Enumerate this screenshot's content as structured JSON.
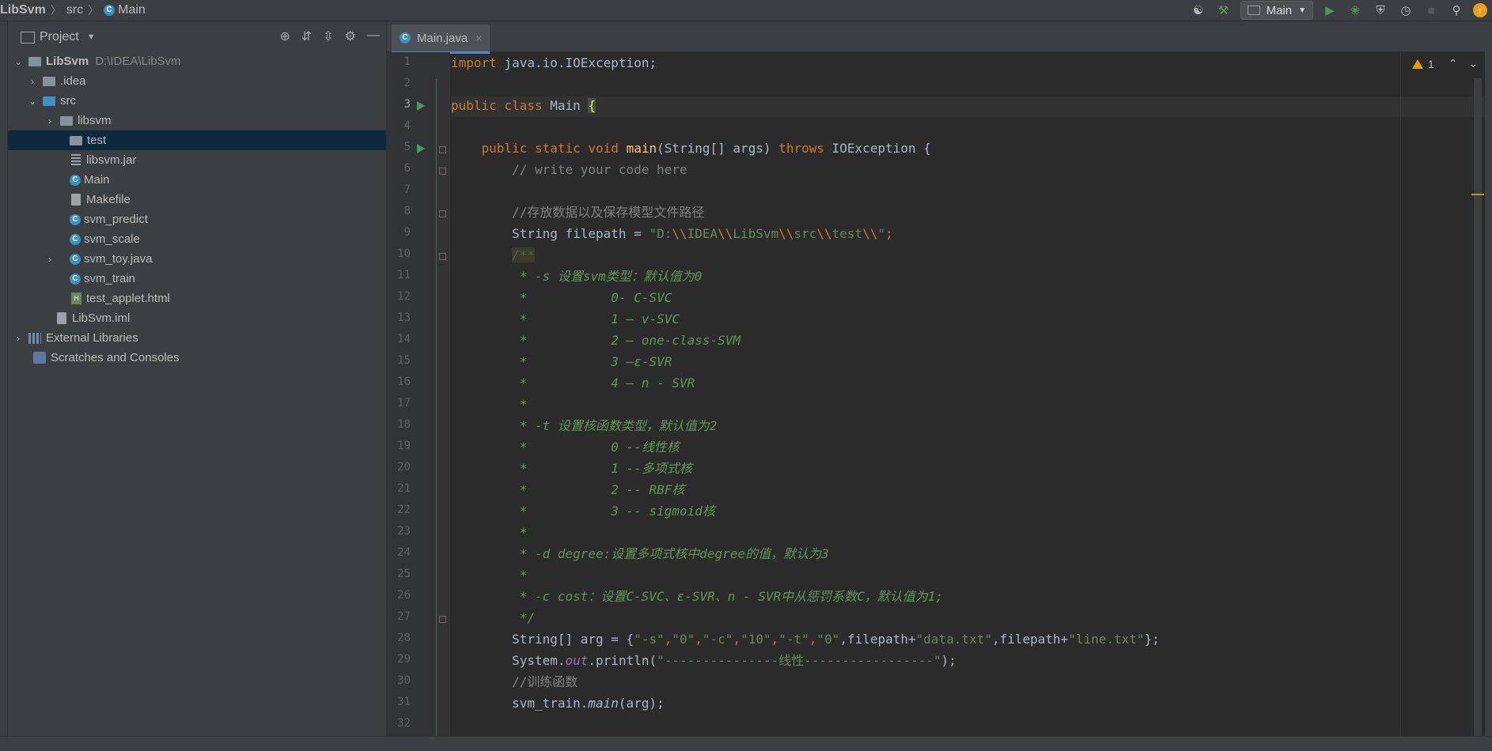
{
  "breadcrumb": {
    "project": "LibSvm",
    "folder": "src",
    "file": "Main"
  },
  "toolbar": {
    "run_config": "Main"
  },
  "project_panel": {
    "title": "Project",
    "root_name": "LibSvm",
    "root_path": "D:\\IDEA\\LibSvm",
    "items": {
      "idea": ".idea",
      "src": "src",
      "libsvm": "libsvm",
      "test": "test",
      "libsvm_jar": "libsvm.jar",
      "main": "Main",
      "makefile": "Makefile",
      "svm_predict": "svm_predict",
      "svm_scale": "svm_scale",
      "svm_toy": "svm_toy.java",
      "svm_train": "svm_train",
      "test_applet": "test_applet.html",
      "iml": "LibSvm.iml",
      "external_libraries": "External Libraries",
      "scratches": "Scratches and Consoles"
    }
  },
  "editor": {
    "tab": "Main.java",
    "current_line": 3,
    "warning_count": "1",
    "line_numbers": [
      "1",
      "2",
      "3",
      "4",
      "5",
      "6",
      "7",
      "8",
      "9",
      "10",
      "11",
      "12",
      "13",
      "14",
      "15",
      "16",
      "17",
      "18",
      "19",
      "20",
      "21",
      "22",
      "23",
      "24",
      "25",
      "26",
      "27",
      "28",
      "29",
      "30",
      "31",
      "32"
    ],
    "code": {
      "l1_kw": "import",
      "l1_rest": " java.io.IOException;",
      "l3_kw": "public class",
      "l3_rest": " Main ",
      "l3_brace": "{",
      "l5_kw1": "    public static void ",
      "l5_fn": "main",
      "l5_mid": "(String[] args) ",
      "l5_kw2": "throws",
      "l5_rest": " IOException {",
      "l6": "        // write your code here",
      "l8": "        //存放数据以及保存模型文件路径",
      "l9_a": "        String filepath = ",
      "l9_s1": "\"D:",
      "l9_e1": "\\\\",
      "l9_s2": "IDEA",
      "l9_e2": "\\\\",
      "l9_s3": "LibSvm",
      "l9_e3": "\\\\",
      "l9_s4": "src",
      "l9_e4": "\\\\",
      "l9_s5": "test",
      "l9_e5": "\\\\",
      "l9_s6": "\"",
      "l9_end": ";",
      "l10_pre": "        ",
      "l10_doc": "/**",
      "l11": "         * -s 设置svm类型：默认值为0",
      "l12": "         *           0- C-SVC",
      "l13": "         *           1 – v-SVC",
      "l14": "         *           2 – one-class-SVM",
      "l15": "         *           3 –ε-SVR",
      "l16": "         *           4 – n - SVR",
      "l17": "         *",
      "l18": "         * -t 设置核函数类型，默认值为2",
      "l19": "         *           0 --线性核",
      "l20": "         *           1 --多项式核",
      "l21": "         *           2 -- RBF核",
      "l22": "         *           3 -- sigmoid核",
      "l23": "         *",
      "l24": "         * -d degree:设置多项式核中degree的值，默认为3",
      "l25": "         *",
      "l26": "         * -c cost：设置C-SVC、ε-SVR、n - SVR中从惩罚系数C，默认值为1;",
      "l27": "         */",
      "l28_a": "        String[] arg = {",
      "l28_s1": "\"-s\"",
      "l28_c1": ",",
      "l28_s2": "\"0\"",
      "l28_c2": ",",
      "l28_s3": "\"-c\"",
      "l28_c3": ",",
      "l28_s4": "\"10\"",
      "l28_c4": ",",
      "l28_s5": "\"-t\"",
      "l28_c5": ",",
      "l28_s6": "\"0\"",
      "l28_c6": ",filepath+",
      "l28_s7": "\"data.txt\"",
      "l28_c7": ",filepath+",
      "l28_s8": "\"line.txt\"",
      "l28_end": "};",
      "l29_a": "        System.",
      "l29_f": "out",
      "l29_b": ".println(",
      "l29_s": "\"---------------线性-----------------\"",
      "l29_end": ");",
      "l30": "        //训练函数",
      "l31_a": "        svm_train.",
      "l31_f": "main",
      "l31_end": "(arg);"
    }
  },
  "colors": {
    "background": "#2b2b2b",
    "panel": "#3c3f41",
    "keyword": "#cc7832",
    "function": "#ffc66d",
    "doc_comment": "#629755",
    "string": "#6a8759",
    "run_green": "#499c54",
    "accent_blue": "#4a88c7"
  }
}
